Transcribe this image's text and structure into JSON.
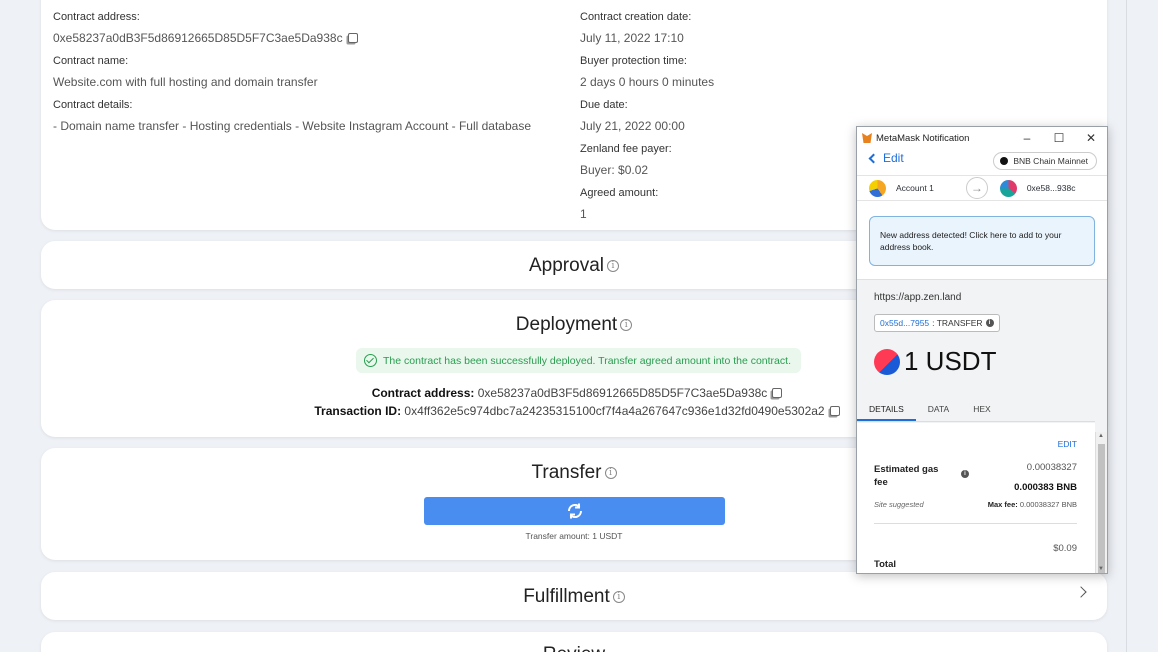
{
  "info": {
    "contract_address_label": "Contract address:",
    "contract_address": "0xe58237a0dB3F5d86912665D85D5F7C3ae5Da938c",
    "contract_name_label": "Contract name:",
    "contract_name": "Website.com with full hosting and domain transfer",
    "contract_details_label": "Contract details:",
    "contract_details": "- Domain name transfer - Hosting credentials - Website Instagram Account - Full database",
    "creation_date_label": "Contract creation date:",
    "creation_date": "July 11, 2022 17:10",
    "buyer_protection_label": "Buyer protection time:",
    "buyer_protection": "2 days 0 hours 0 minutes",
    "due_date_label": "Due date:",
    "due_date": "July 21, 2022 00:00",
    "fee_payer_label": "Zenland fee payer:",
    "fee_payer": "Buyer: $0.02",
    "agreed_amount_label": "Agreed amount:",
    "agreed_amount": "1"
  },
  "approval": {
    "title": "Approval"
  },
  "deployment": {
    "title": "Deployment",
    "success_msg": "The contract has been successfully deployed. Transfer agreed amount into the contract.",
    "contract_address_label": "Contract address:",
    "contract_address": "0xe58237a0dB3F5d86912665D85D5F7C3ae5Da938c",
    "tx_label": "Transaction ID:",
    "tx_id": "0x4ff362e5c974dbc7a24235315100cf7f4a4a267647c936e1d32fd0490e5302a2"
  },
  "transfer": {
    "title": "Transfer",
    "amount_text": "Transfer amount: 1 USDT"
  },
  "fulfillment": {
    "title": "Fulfillment"
  },
  "review": {
    "title": "Review"
  },
  "metamask": {
    "window_title": "MetaMask Notification",
    "edit": "Edit",
    "network": "BNB Chain Mainnet",
    "from_account": "Account 1",
    "to_account": "0xe58...938c",
    "notice": "New address detected! Click here to add to your address book.",
    "origin": "https://app.zen.land",
    "method_addr": "0x55d...7955",
    "method_name": ": TRANSFER",
    "amount": "1 USDT",
    "tabs": [
      "DETAILS",
      "DATA",
      "HEX"
    ],
    "edit_link": "EDIT",
    "gas_label": "Estimated gas fee",
    "gas_usd": "0.00038327",
    "gas_bnb": "0.000383 BNB",
    "site_suggested": "Site suggested",
    "max_fee_label": "Max fee:",
    "max_fee": "0.00038327 BNB",
    "total_usd": "$0.09",
    "total_label": "Total"
  }
}
